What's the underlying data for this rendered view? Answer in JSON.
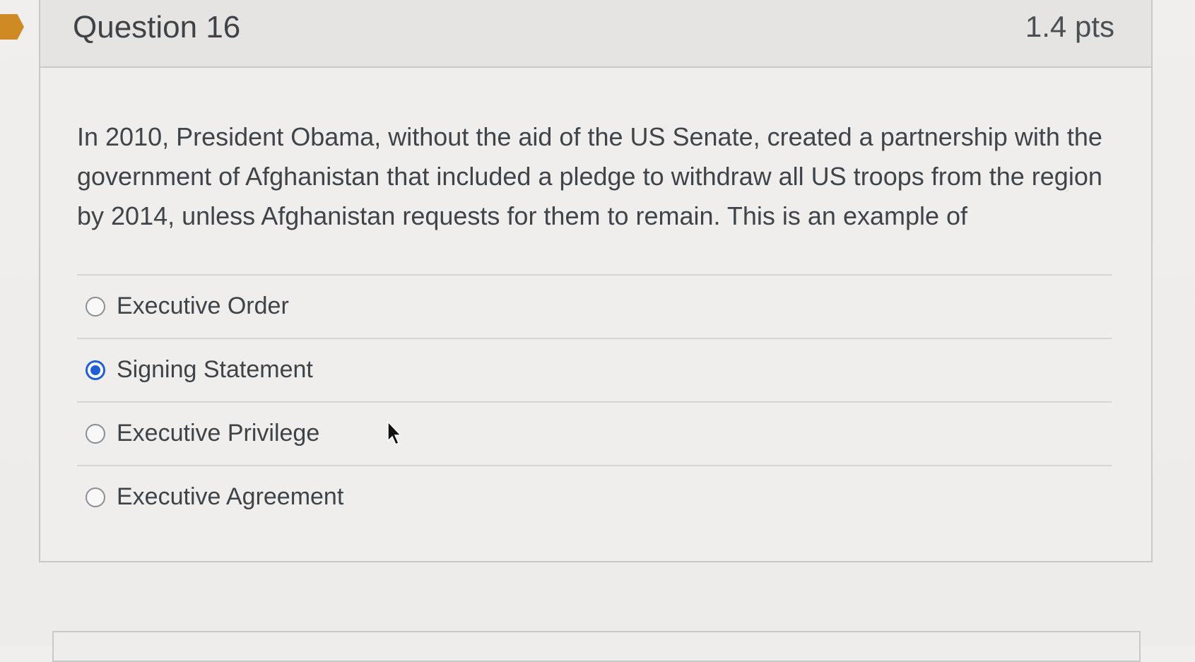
{
  "question": {
    "title": "Question 16",
    "points": "1.4 pts",
    "text": "In 2010, President Obama, without the aid of the US Senate, created a partnership with the government of Afghanistan that included a pledge to withdraw all US troops from the region by 2014, unless Afghanistan requests for them to remain. This is an example of"
  },
  "answers": [
    {
      "label": "Executive Order",
      "selected": false
    },
    {
      "label": "Signing Statement",
      "selected": true
    },
    {
      "label": "Executive Privilege",
      "selected": false
    },
    {
      "label": "Executive Agreement",
      "selected": false
    }
  ],
  "colors": {
    "accent": "#1e5fd6",
    "bookmark": "#d08a24",
    "text": "#3e4348"
  },
  "icons": {
    "bookmark": "bookmark-flag-icon",
    "cursor": "mouse-pointer-icon",
    "radio": "radio-button-icon"
  }
}
